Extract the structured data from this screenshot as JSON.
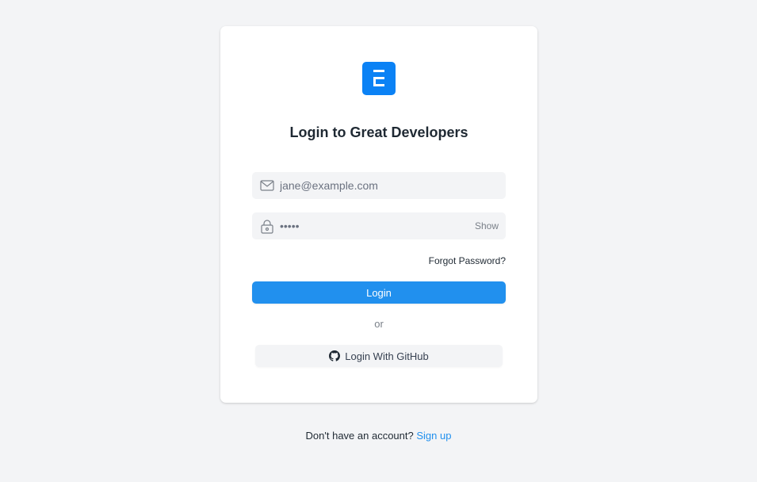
{
  "app": {
    "title": "Login to Great Developers",
    "logo_icon": "brand-e-logo",
    "accent_color": "#0b82f5"
  },
  "email": {
    "placeholder": "jane@example.com",
    "value": "",
    "icon": "envelope-icon"
  },
  "password": {
    "value": "•••••",
    "icon": "lock-icon",
    "toggle_label": "Show"
  },
  "forgot_label": "Forgot Password?",
  "login_label": "Login",
  "divider_label": "or",
  "github": {
    "label": "Login With GitHub",
    "icon": "github-icon"
  },
  "signup": {
    "prompt": "Don't have an account?",
    "link_label": "Sign up"
  }
}
